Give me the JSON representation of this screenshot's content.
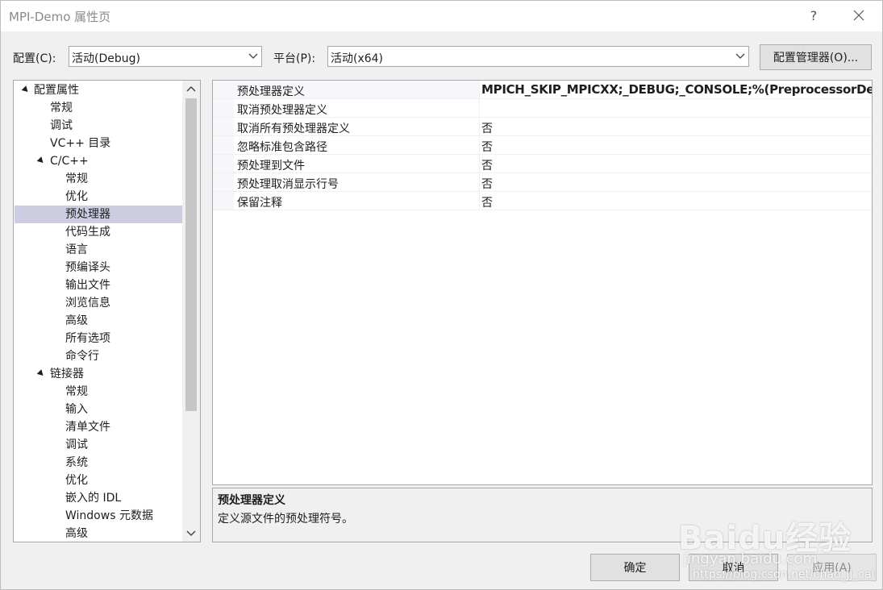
{
  "window": {
    "title": "MPI-Demo 属性页",
    "help_label": "?"
  },
  "config": {
    "config_label": "配置(C):",
    "config_value": "活动(Debug)",
    "platform_label": "平台(P):",
    "platform_value": "活动(x64)",
    "manager_button": "配置管理器(O)..."
  },
  "tree": {
    "items": [
      {
        "label": "配置属性",
        "level": 0,
        "expanded": true
      },
      {
        "label": "常规",
        "level": 1
      },
      {
        "label": "调试",
        "level": 1
      },
      {
        "label": "VC++ 目录",
        "level": 1
      },
      {
        "label": "C/C++",
        "level": 1,
        "expanded": true
      },
      {
        "label": "常规",
        "level": 2
      },
      {
        "label": "优化",
        "level": 2
      },
      {
        "label": "预处理器",
        "level": 2,
        "selected": true
      },
      {
        "label": "代码生成",
        "level": 2
      },
      {
        "label": "语言",
        "level": 2
      },
      {
        "label": "预编译头",
        "level": 2
      },
      {
        "label": "输出文件",
        "level": 2
      },
      {
        "label": "浏览信息",
        "level": 2
      },
      {
        "label": "高级",
        "level": 2
      },
      {
        "label": "所有选项",
        "level": 2
      },
      {
        "label": "命令行",
        "level": 2
      },
      {
        "label": "链接器",
        "level": 1,
        "expanded": true
      },
      {
        "label": "常规",
        "level": 2
      },
      {
        "label": "输入",
        "level": 2
      },
      {
        "label": "清单文件",
        "level": 2
      },
      {
        "label": "调试",
        "level": 2
      },
      {
        "label": "系统",
        "level": 2
      },
      {
        "label": "优化",
        "level": 2
      },
      {
        "label": "嵌入的 IDL",
        "level": 2
      },
      {
        "label": "Windows 元数据",
        "level": 2
      },
      {
        "label": "高级",
        "level": 2
      }
    ]
  },
  "properties": [
    {
      "name": "预处理器定义",
      "value": "MPICH_SKIP_MPICXX;_DEBUG;_CONSOLE;%(PreprocessorDefinit",
      "bold": true
    },
    {
      "name": "取消预处理器定义",
      "value": ""
    },
    {
      "name": "取消所有预处理器定义",
      "value": "否"
    },
    {
      "name": "忽略标准包含路径",
      "value": "否"
    },
    {
      "name": "预处理到文件",
      "value": "否"
    },
    {
      "name": "预处理取消显示行号",
      "value": "否"
    },
    {
      "name": "保留注释",
      "value": "否"
    }
  ],
  "description": {
    "title": "预处理器定义",
    "text": "定义源文件的预处理符号。"
  },
  "buttons": {
    "ok": "确定",
    "cancel": "取消",
    "apply": "应用(A)"
  },
  "watermark": {
    "brand": "Baidu经验",
    "sub": "jingyan.baidu.com",
    "url": "https://blog.csdn.net/chao_jj_cai"
  },
  "colors": {
    "selected_tree_item": "#cdcde1",
    "dialog_bg": "#f0f0f0"
  }
}
